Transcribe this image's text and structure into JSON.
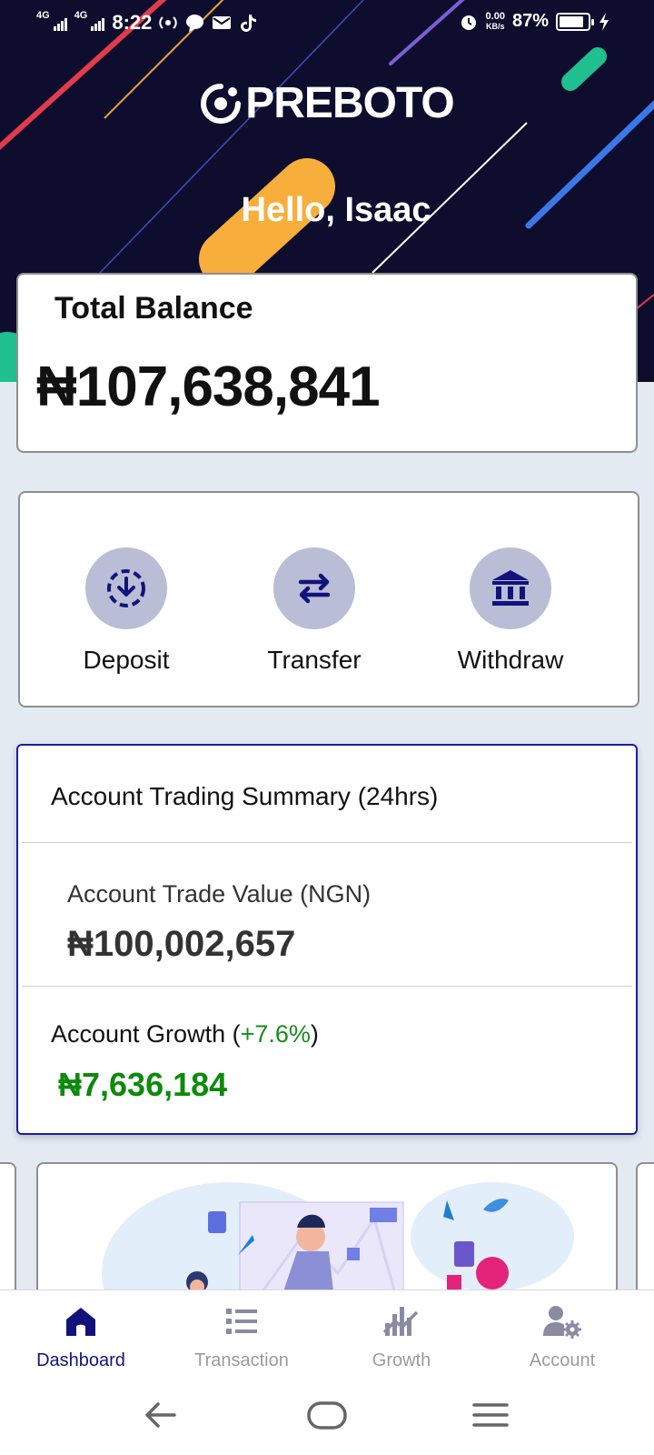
{
  "status_bar": {
    "network_1": "4G",
    "network_2": "4G",
    "time": "8:22",
    "speed_value": "0.00",
    "speed_unit": "KB/s",
    "battery_percent": "87%",
    "battery_level": 0.87
  },
  "brand": {
    "name": "PREBOTO"
  },
  "greeting": "Hello, Isaac",
  "balance": {
    "label": "Total Balance",
    "value": "₦107,638,841"
  },
  "actions": [
    {
      "label": "Deposit",
      "icon": "deposit-icon"
    },
    {
      "label": "Transfer",
      "icon": "transfer-icon"
    },
    {
      "label": "Withdraw",
      "icon": "bank-icon"
    }
  ],
  "summary": {
    "title": "Account Trading Summary (24hrs)",
    "trade_label": "Account Trade Value (NGN)",
    "trade_value": "₦100,002,657",
    "growth_label": "Account Growth (",
    "growth_pct": "+7.6%",
    "growth_close": ")",
    "growth_value": "₦7,636,184"
  },
  "bottom_nav": [
    {
      "label": "Dashboard",
      "icon": "home-icon",
      "active": true
    },
    {
      "label": "Transaction",
      "icon": "list-icon",
      "active": false
    },
    {
      "label": "Growth",
      "icon": "chart-icon",
      "active": false
    },
    {
      "label": "Account",
      "icon": "user-settings-icon",
      "active": false
    }
  ],
  "colors": {
    "hero_bg": "#0e0d2e",
    "accent_navy": "#12137a",
    "action_circle": "#b9bdd6",
    "growth_green": "#0d8a0d",
    "summary_border": "#1b1f9e"
  }
}
